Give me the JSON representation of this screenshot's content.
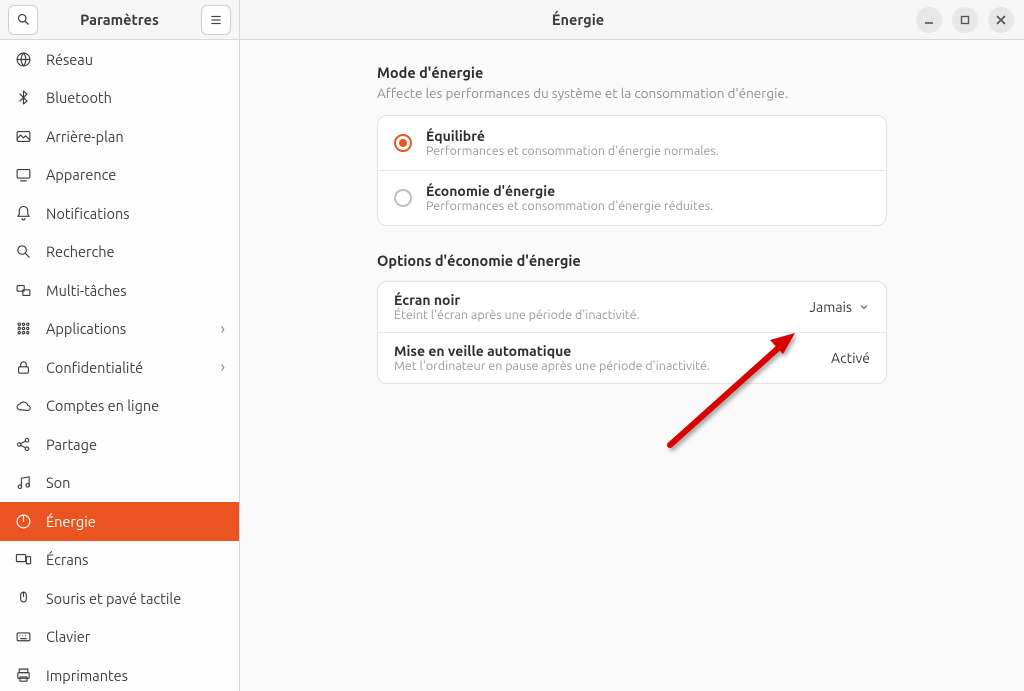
{
  "titlebar": {
    "app_title": "Paramètres",
    "page_title": "Énergie"
  },
  "sidebar": {
    "items": [
      {
        "icon": "globe",
        "label": "Réseau",
        "active": false,
        "chev": false
      },
      {
        "icon": "bluetooth",
        "label": "Bluetooth",
        "active": false,
        "chev": false
      },
      {
        "icon": "background",
        "label": "Arrière-plan",
        "active": false,
        "chev": false
      },
      {
        "icon": "appearance",
        "label": "Apparence",
        "active": false,
        "chev": false
      },
      {
        "icon": "bell",
        "label": "Notifications",
        "active": false,
        "chev": false
      },
      {
        "icon": "search",
        "label": "Recherche",
        "active": false,
        "chev": false
      },
      {
        "icon": "multi",
        "label": "Multi-tâches",
        "active": false,
        "chev": false
      },
      {
        "icon": "apps",
        "label": "Applications",
        "active": false,
        "chev": true
      },
      {
        "icon": "lock",
        "label": "Confidentialité",
        "active": false,
        "chev": true
      },
      {
        "icon": "cloud",
        "label": "Comptes en ligne",
        "active": false,
        "chev": false
      },
      {
        "icon": "share",
        "label": "Partage",
        "active": false,
        "chev": false
      },
      {
        "icon": "music",
        "label": "Son",
        "active": false,
        "chev": false
      },
      {
        "icon": "power",
        "label": "Énergie",
        "active": true,
        "chev": false
      },
      {
        "icon": "screens",
        "label": "Écrans",
        "active": false,
        "chev": false
      },
      {
        "icon": "mouse",
        "label": "Souris et pavé tactile",
        "active": false,
        "chev": false
      },
      {
        "icon": "keyboard",
        "label": "Clavier",
        "active": false,
        "chev": false
      },
      {
        "icon": "printer",
        "label": "Imprimantes",
        "active": false,
        "chev": false
      }
    ]
  },
  "section_mode": {
    "title": "Mode d'énergie",
    "subtitle": "Affecte les performances du système et la consommation d'énergie.",
    "options": [
      {
        "title": "Équilibré",
        "sub": "Performances et consommation d'énergie normales.",
        "selected": true
      },
      {
        "title": "Économie d'énergie",
        "sub": "Performances et consommation d'énergie réduites.",
        "selected": false
      }
    ]
  },
  "section_saving": {
    "title": "Options d'économie d'énergie",
    "rows": [
      {
        "title": "Écran noir",
        "sub": "Éteint l'écran après une période d'inactivité.",
        "value": "Jamais",
        "chev": true
      },
      {
        "title": "Mise en veille automatique",
        "sub": "Met l'ordinateur en pause après une période d'inactivité.",
        "value": "Activé",
        "chev": false
      }
    ]
  },
  "colors": {
    "accent": "#e95420"
  }
}
